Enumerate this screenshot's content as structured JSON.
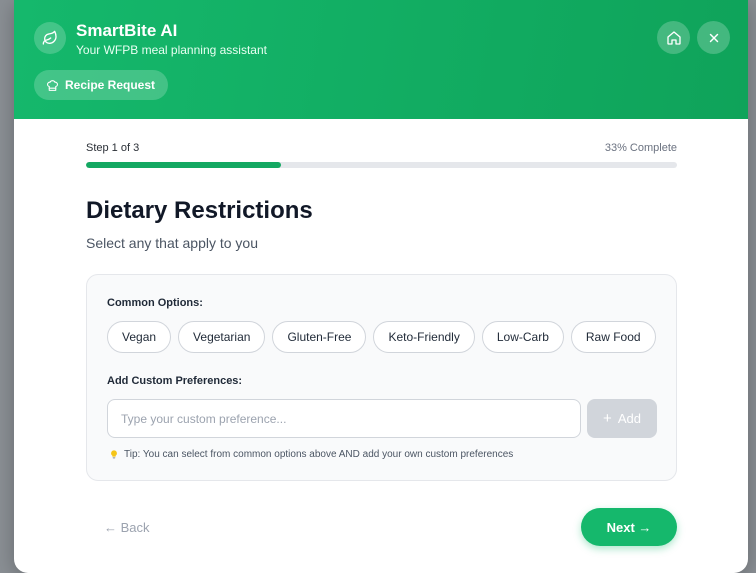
{
  "header": {
    "title": "SmartBite AI",
    "subtitle": "Your WFPB meal planning assistant",
    "chip_label": "Recipe Request",
    "accent": "#15b86c"
  },
  "progress": {
    "step_label": "Step 1 of 3",
    "percent_label": "33% Complete",
    "percent": 33
  },
  "page": {
    "title": "Dietary Restrictions",
    "subtitle": "Select any that apply to you"
  },
  "options": {
    "common_label": "Common Options:",
    "items": [
      "Vegan",
      "Vegetarian",
      "Gluten-Free",
      "Keto-Friendly",
      "Low-Carb",
      "Raw Food"
    ],
    "custom_label": "Add Custom Preferences:",
    "custom_placeholder": "Type your custom preference...",
    "add_label": "Add",
    "tip": "Tip: You can select from common options above AND add your own custom preferences"
  },
  "nav": {
    "back_label": "← Back",
    "next_label": "Next →"
  }
}
